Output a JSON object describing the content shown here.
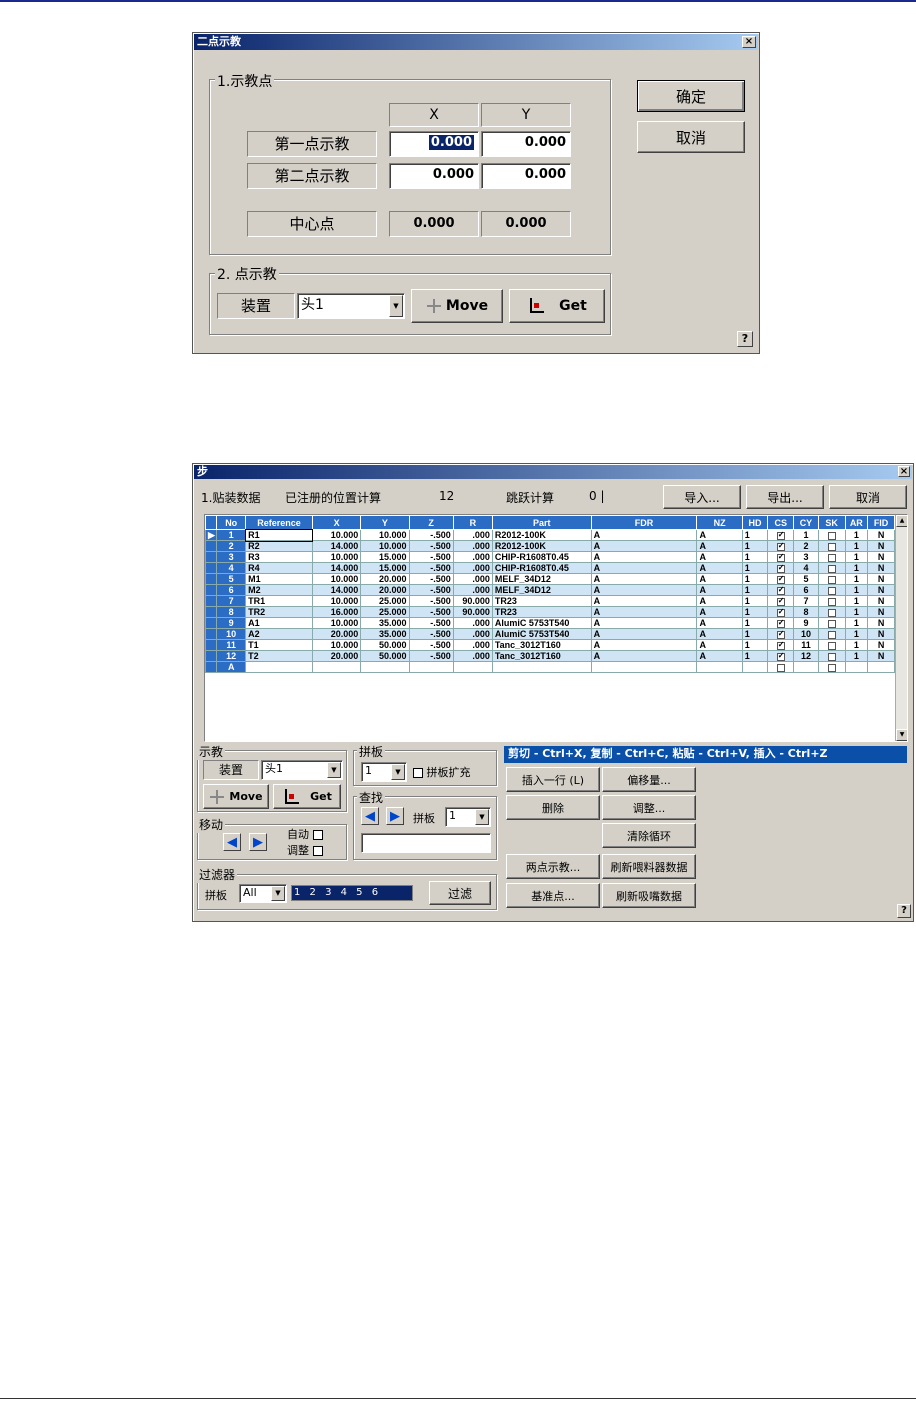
{
  "dialog1": {
    "title": "二点示教",
    "close": "×",
    "group1_legend": "1.示教点",
    "col_x": "X",
    "col_y": "Y",
    "rows": [
      {
        "label": "第一点示教",
        "x": "0.000",
        "y": "0.000"
      },
      {
        "label": "第二点示教",
        "x": "0.000",
        "y": "0.000"
      }
    ],
    "center_label": "中心点",
    "center_x": "0.000",
    "center_y": "0.000",
    "ok": "确定",
    "cancel": "取消",
    "group2_legend": "2. 点示教",
    "device_label": "装置",
    "device_value": "头1",
    "move": "Move",
    "get": "Get",
    "help": "?"
  },
  "dialog2": {
    "title": "步",
    "close": "×",
    "header_label": "1.贴装数据",
    "registered_label": "已注册的位置计算",
    "registered_count": "12",
    "skip_label": "跳跃计算",
    "skip_count": "0 |",
    "import": "导入...",
    "export": "导出...",
    "cancel": "取消",
    "columns": [
      "No",
      "Reference",
      "X",
      "Y",
      "Z",
      "R",
      "Part",
      "FDR",
      "NZ",
      "HD",
      "CS",
      "CY",
      "SK",
      "AR",
      "FID"
    ],
    "rows": [
      {
        "no": "1",
        "ref": "R1",
        "x": "10.000",
        "y": "10.000",
        "z": "-.500",
        "r": ".000",
        "part": "R2012-100K",
        "fdr": "A",
        "nz": "A",
        "hd": "1",
        "cs": true,
        "cy": "1",
        "sk": false,
        "ar": "1",
        "fid": "N"
      },
      {
        "no": "2",
        "ref": "R2",
        "x": "14.000",
        "y": "10.000",
        "z": "-.500",
        "r": ".000",
        "part": "R2012-100K",
        "fdr": "A",
        "nz": "A",
        "hd": "1",
        "cs": true,
        "cy": "2",
        "sk": false,
        "ar": "1",
        "fid": "N"
      },
      {
        "no": "3",
        "ref": "R3",
        "x": "10.000",
        "y": "15.000",
        "z": "-.500",
        "r": ".000",
        "part": "CHIP-R1608T0.45",
        "fdr": "A",
        "nz": "A",
        "hd": "1",
        "cs": true,
        "cy": "3",
        "sk": false,
        "ar": "1",
        "fid": "N"
      },
      {
        "no": "4",
        "ref": "R4",
        "x": "14.000",
        "y": "15.000",
        "z": "-.500",
        "r": ".000",
        "part": "CHIP-R1608T0.45",
        "fdr": "A",
        "nz": "A",
        "hd": "1",
        "cs": true,
        "cy": "4",
        "sk": false,
        "ar": "1",
        "fid": "N"
      },
      {
        "no": "5",
        "ref": "M1",
        "x": "10.000",
        "y": "20.000",
        "z": "-.500",
        "r": ".000",
        "part": "MELF_34D12",
        "fdr": "A",
        "nz": "A",
        "hd": "1",
        "cs": true,
        "cy": "5",
        "sk": false,
        "ar": "1",
        "fid": "N"
      },
      {
        "no": "6",
        "ref": "M2",
        "x": "14.000",
        "y": "20.000",
        "z": "-.500",
        "r": ".000",
        "part": "MELF_34D12",
        "fdr": "A",
        "nz": "A",
        "hd": "1",
        "cs": true,
        "cy": "6",
        "sk": false,
        "ar": "1",
        "fid": "N"
      },
      {
        "no": "7",
        "ref": "TR1",
        "x": "10.000",
        "y": "25.000",
        "z": "-.500",
        "r": "90.000",
        "part": "TR23",
        "fdr": "A",
        "nz": "A",
        "hd": "1",
        "cs": true,
        "cy": "7",
        "sk": false,
        "ar": "1",
        "fid": "N"
      },
      {
        "no": "8",
        "ref": "TR2",
        "x": "16.000",
        "y": "25.000",
        "z": "-.500",
        "r": "90.000",
        "part": "TR23",
        "fdr": "A",
        "nz": "A",
        "hd": "1",
        "cs": true,
        "cy": "8",
        "sk": false,
        "ar": "1",
        "fid": "N"
      },
      {
        "no": "9",
        "ref": "A1",
        "x": "10.000",
        "y": "35.000",
        "z": "-.500",
        "r": ".000",
        "part": "AlumiC 5753T540",
        "fdr": "A",
        "nz": "A",
        "hd": "1",
        "cs": true,
        "cy": "9",
        "sk": false,
        "ar": "1",
        "fid": "N"
      },
      {
        "no": "10",
        "ref": "A2",
        "x": "20.000",
        "y": "35.000",
        "z": "-.500",
        "r": ".000",
        "part": "AlumiC 5753T540",
        "fdr": "A",
        "nz": "A",
        "hd": "1",
        "cs": true,
        "cy": "10",
        "sk": false,
        "ar": "1",
        "fid": "N"
      },
      {
        "no": "11",
        "ref": "T1",
        "x": "10.000",
        "y": "50.000",
        "z": "-.500",
        "r": ".000",
        "part": "Tanc_3012T160",
        "fdr": "A",
        "nz": "A",
        "hd": "1",
        "cs": true,
        "cy": "11",
        "sk": false,
        "ar": "1",
        "fid": "N"
      },
      {
        "no": "12",
        "ref": "T2",
        "x": "20.000",
        "y": "50.000",
        "z": "-.500",
        "r": ".000",
        "part": "Tanc_3012T160",
        "fdr": "A",
        "nz": "A",
        "hd": "1",
        "cs": true,
        "cy": "12",
        "sk": false,
        "ar": "1",
        "fid": "N"
      }
    ],
    "new_row_label": "A",
    "teach_legend": "示教",
    "device_label": "装置",
    "device_value": "头1",
    "move": "Move",
    "get": "Get",
    "panel_legend": "拼板",
    "panel_value": "1",
    "panel_expand": "拼板扩充",
    "find_legend": "查找",
    "find_panel_label": "拼板",
    "find_panel_value": "1",
    "shift_legend": "移动",
    "auto_label": "自动",
    "adjust_label": "调整",
    "filter_legend": "过滤器",
    "filter_panel_label": "拼板",
    "filter_panel_value": "All",
    "filter_list": "1 2 3 4 5 6",
    "filter_button": "过滤",
    "shortcut_text": "剪切 - Ctrl+X, 复制 - Ctrl+C, 粘贴 - Ctrl+V, 插入 - Ctrl+Z",
    "insert_row": "插入一行 (L)",
    "offset": "偏移量...",
    "delete": "删除",
    "adjust": "调整...",
    "clear_loop": "清除循环",
    "two_point": "两点示教...",
    "refresh_feeder": "刷新喂料器数据",
    "base_point": "基准点...",
    "refresh_nozzle": "刷新吸嘴数据",
    "help": "?"
  }
}
